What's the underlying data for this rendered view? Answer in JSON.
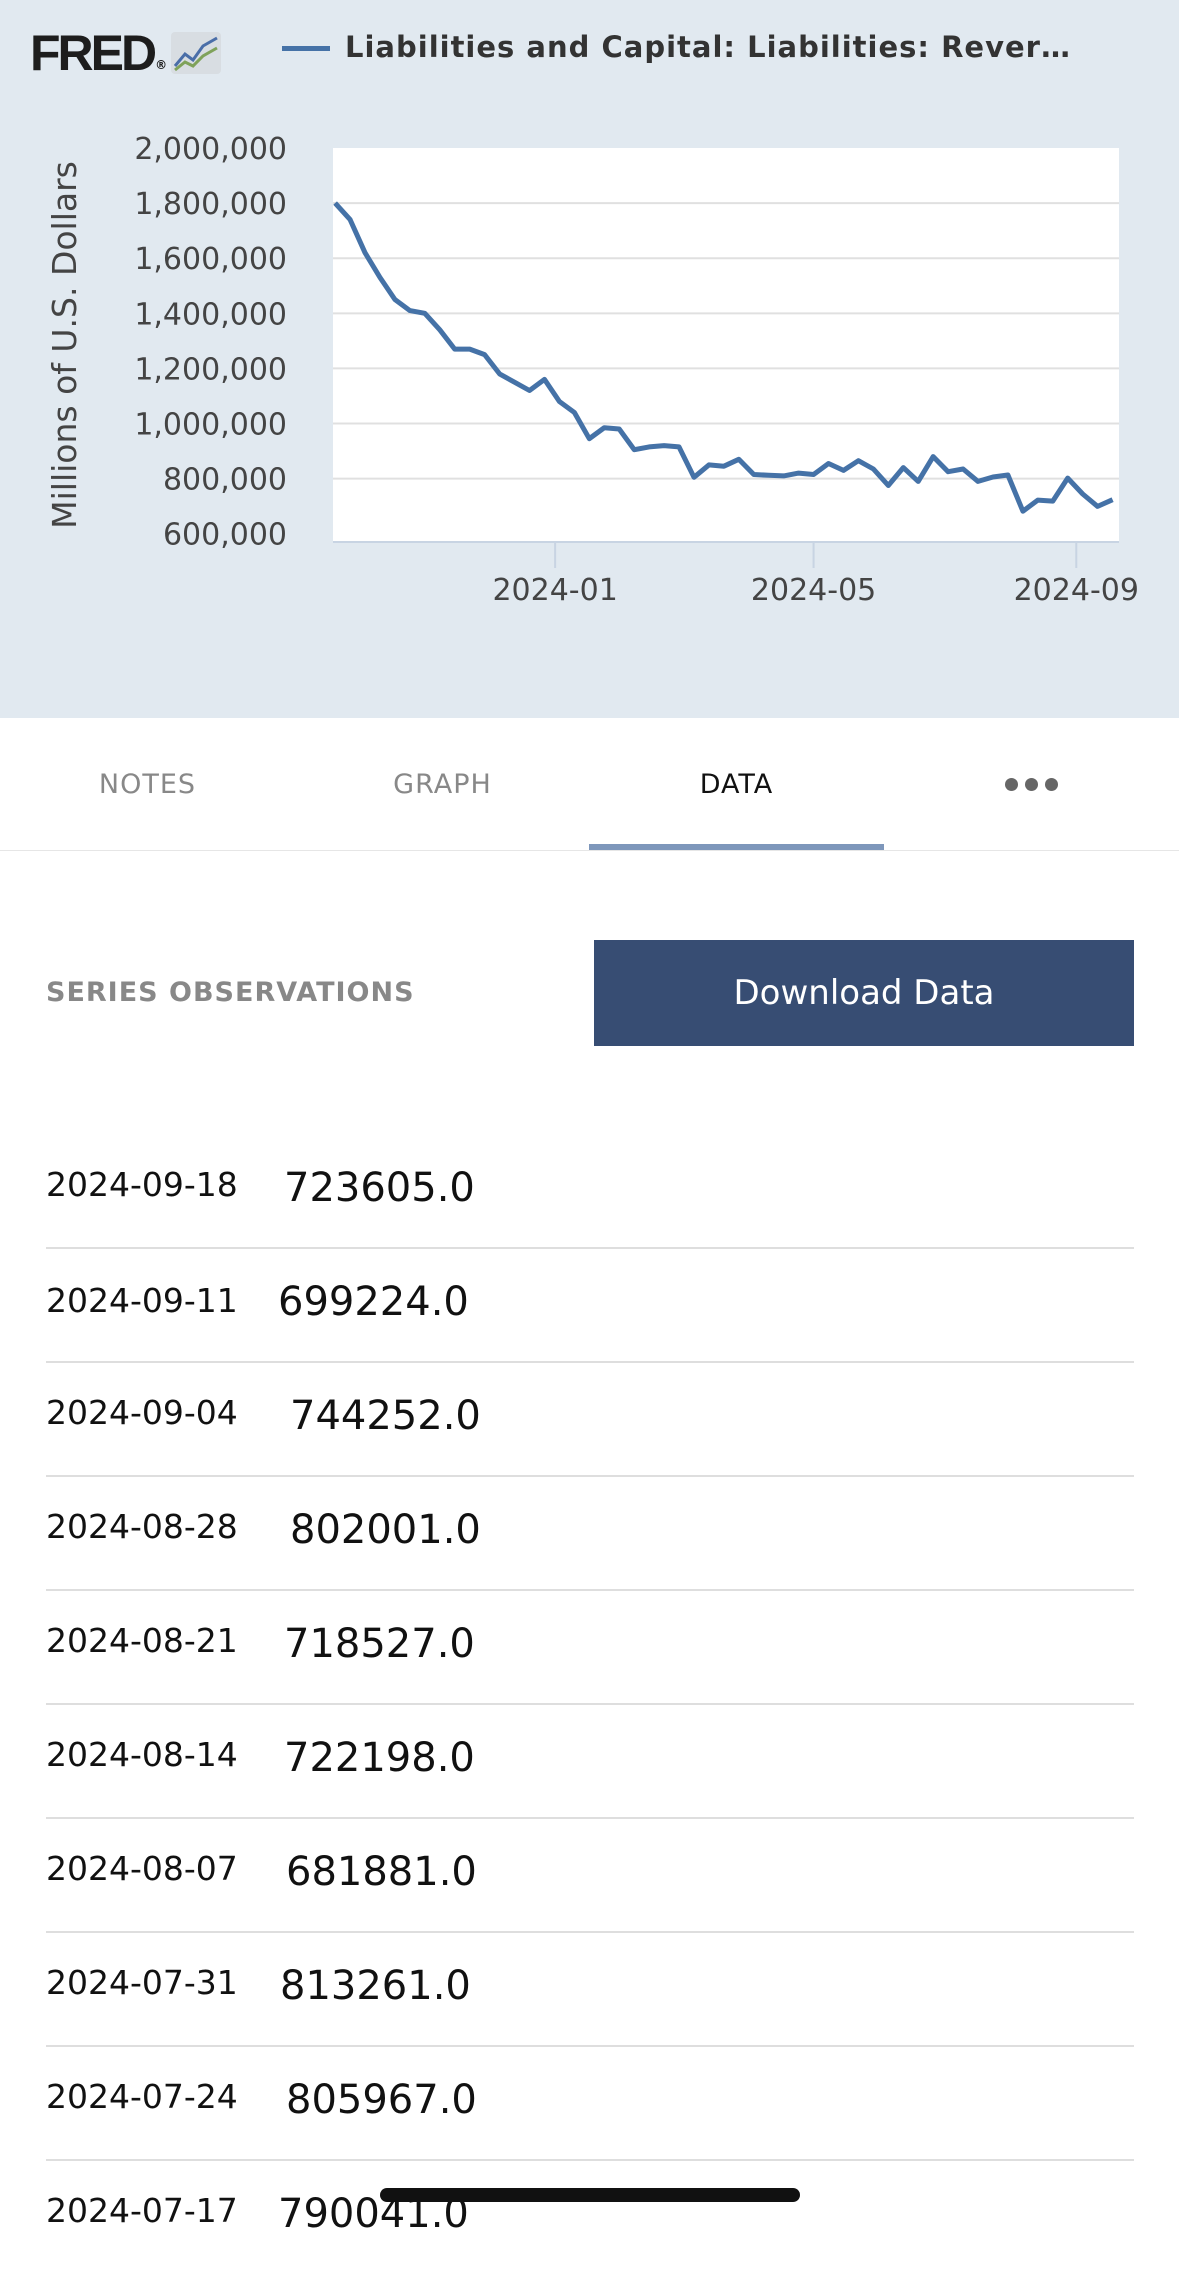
{
  "header": {
    "logo_text": "FRED",
    "logo_registered": "®",
    "series_title": "Liabilities and Capital: Liabilities: Rever…"
  },
  "colors": {
    "chart_background": "#e1e9f0",
    "plot_background": "#ffffff",
    "series_line": "#4572a7",
    "download_button": "#374d73",
    "tab_indicator": "#7e97bb"
  },
  "chart_data": {
    "type": "line",
    "ylabel": "Millions of U.S. Dollars",
    "ylim": [
      600000,
      2000000
    ],
    "y_ticks": [
      "2,000,000",
      "1,800,000",
      "1,600,000",
      "1,400,000",
      "1,200,000",
      "1,000,000",
      "800,000",
      "600,000"
    ],
    "y_tick_values": [
      2000000,
      1800000,
      1600000,
      1400000,
      1200000,
      1000000,
      800000,
      600000
    ],
    "x_ticks": [
      "2024-01",
      "2024-05",
      "2024-09"
    ],
    "x_tick_dates": [
      "2024-01-01",
      "2024-05-01",
      "2024-09-01"
    ],
    "grid": true,
    "x": [
      "2023-09-20",
      "2023-09-27",
      "2023-10-04",
      "2023-10-11",
      "2023-10-18",
      "2023-10-25",
      "2023-11-01",
      "2023-11-08",
      "2023-11-15",
      "2023-11-22",
      "2023-11-29",
      "2023-12-06",
      "2023-12-13",
      "2023-12-20",
      "2023-12-27",
      "2024-01-03",
      "2024-01-10",
      "2024-01-17",
      "2024-01-24",
      "2024-01-31",
      "2024-02-07",
      "2024-02-14",
      "2024-02-21",
      "2024-02-28",
      "2024-03-06",
      "2024-03-13",
      "2024-03-20",
      "2024-03-27",
      "2024-04-03",
      "2024-04-10",
      "2024-04-17",
      "2024-04-24",
      "2024-05-01",
      "2024-05-08",
      "2024-05-15",
      "2024-05-22",
      "2024-05-29",
      "2024-06-05",
      "2024-06-12",
      "2024-06-19",
      "2024-06-26",
      "2024-07-03",
      "2024-07-10",
      "2024-07-17",
      "2024-07-24",
      "2024-07-31",
      "2024-08-07",
      "2024-08-14",
      "2024-08-21",
      "2024-08-28",
      "2024-09-04",
      "2024-09-11",
      "2024-09-18"
    ],
    "series": [
      {
        "values": [
          1800000,
          1740000,
          1620000,
          1530000,
          1450000,
          1410000,
          1400000,
          1340000,
          1270000,
          1270000,
          1250000,
          1180000,
          1150000,
          1120000,
          1160000,
          1080000,
          1040000,
          945000,
          985000,
          980000,
          905000,
          915000,
          920000,
          915000,
          805000,
          850000,
          845000,
          870000,
          815000,
          812000,
          810000,
          820000,
          815000,
          855000,
          830000,
          865000,
          835000,
          775000,
          840000,
          790000,
          880000,
          825000,
          835000,
          790000,
          805967,
          813261,
          681881,
          722198,
          718527,
          802001,
          744252,
          699224,
          723605
        ]
      }
    ]
  },
  "tabs": [
    {
      "label": "NOTES"
    },
    {
      "label": "GRAPH"
    },
    {
      "label": "DATA"
    },
    {
      "label": "more-horizontal-icon"
    }
  ],
  "observations": {
    "section_label": "SERIES OBSERVATIONS",
    "download_label": "Download Data",
    "rows": [
      {
        "date": "2024-09-18",
        "value": "723605.0"
      },
      {
        "date": "2024-09-11",
        "value": "699224.0"
      },
      {
        "date": "2024-09-04",
        "value": "744252.0"
      },
      {
        "date": "2024-08-28",
        "value": "802001.0"
      },
      {
        "date": "2024-08-21",
        "value": "718527.0"
      },
      {
        "date": "2024-08-14",
        "value": "722198.0"
      },
      {
        "date": "2024-08-07",
        "value": "681881.0"
      },
      {
        "date": "2024-07-31",
        "value": "813261.0"
      },
      {
        "date": "2024-07-24",
        "value": "805967.0"
      },
      {
        "date": "2024-07-17",
        "value": "790041.0"
      }
    ]
  }
}
